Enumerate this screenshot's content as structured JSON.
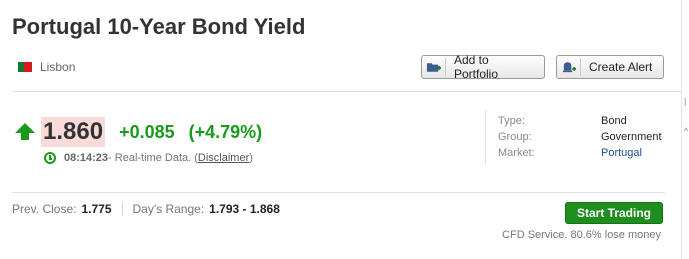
{
  "header": {
    "title": "Portugal 10-Year Bond Yield"
  },
  "location": {
    "flag_icon": "portugal-flag-icon",
    "label": "Lisbon"
  },
  "actions": {
    "add_portfolio_label": "Add to Portfolio",
    "add_portfolio_icon": "folder-plus-icon",
    "create_alert_label": "Create Alert",
    "create_alert_icon": "bell-plus-icon"
  },
  "quote": {
    "direction_icon": "arrow-up-icon",
    "price": "1.860",
    "change": "+0.085",
    "change_pct": "(+4.79%)",
    "time": "08:14:23",
    "data_note": " - Real-time Data. (",
    "disclaimer_label": "Disclaimer",
    "closing_paren": ")"
  },
  "details": [
    {
      "label": "Type:",
      "value": "Bond"
    },
    {
      "label": "Group:",
      "value": "Government"
    },
    {
      "label": "Market:",
      "value": "Portugal"
    }
  ],
  "stats": {
    "prev_close_label": "Prev. Close:",
    "prev_close_value": "1.775",
    "days_range_label": "Day's Range:",
    "days_range_value": "1.793 - 1.868"
  },
  "trading": {
    "start_trading_label": "Start Trading",
    "cfd_note": "CFD Service. 80.6% lose money"
  },
  "colors": {
    "positive": "#1a9a1a",
    "price_highlight": "#fbdada",
    "trade_button": "#1e8f1e",
    "link": "#1a4f8a"
  }
}
